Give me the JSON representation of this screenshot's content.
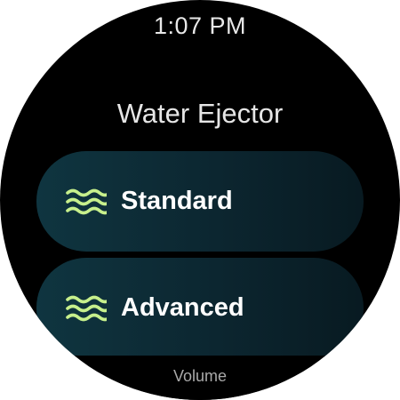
{
  "status": {
    "time": "1:07 PM"
  },
  "screen": {
    "title": "Water Ejector"
  },
  "modes": [
    {
      "label": "Standard",
      "icon": "waves-icon"
    },
    {
      "label": "Advanced",
      "icon": "waves-icon"
    }
  ],
  "footer": {
    "label": "Volume"
  },
  "colors": {
    "background": "#000000",
    "chip": "#0f3540",
    "icon_accent": "#c7f08c",
    "text": "#ffffff"
  }
}
